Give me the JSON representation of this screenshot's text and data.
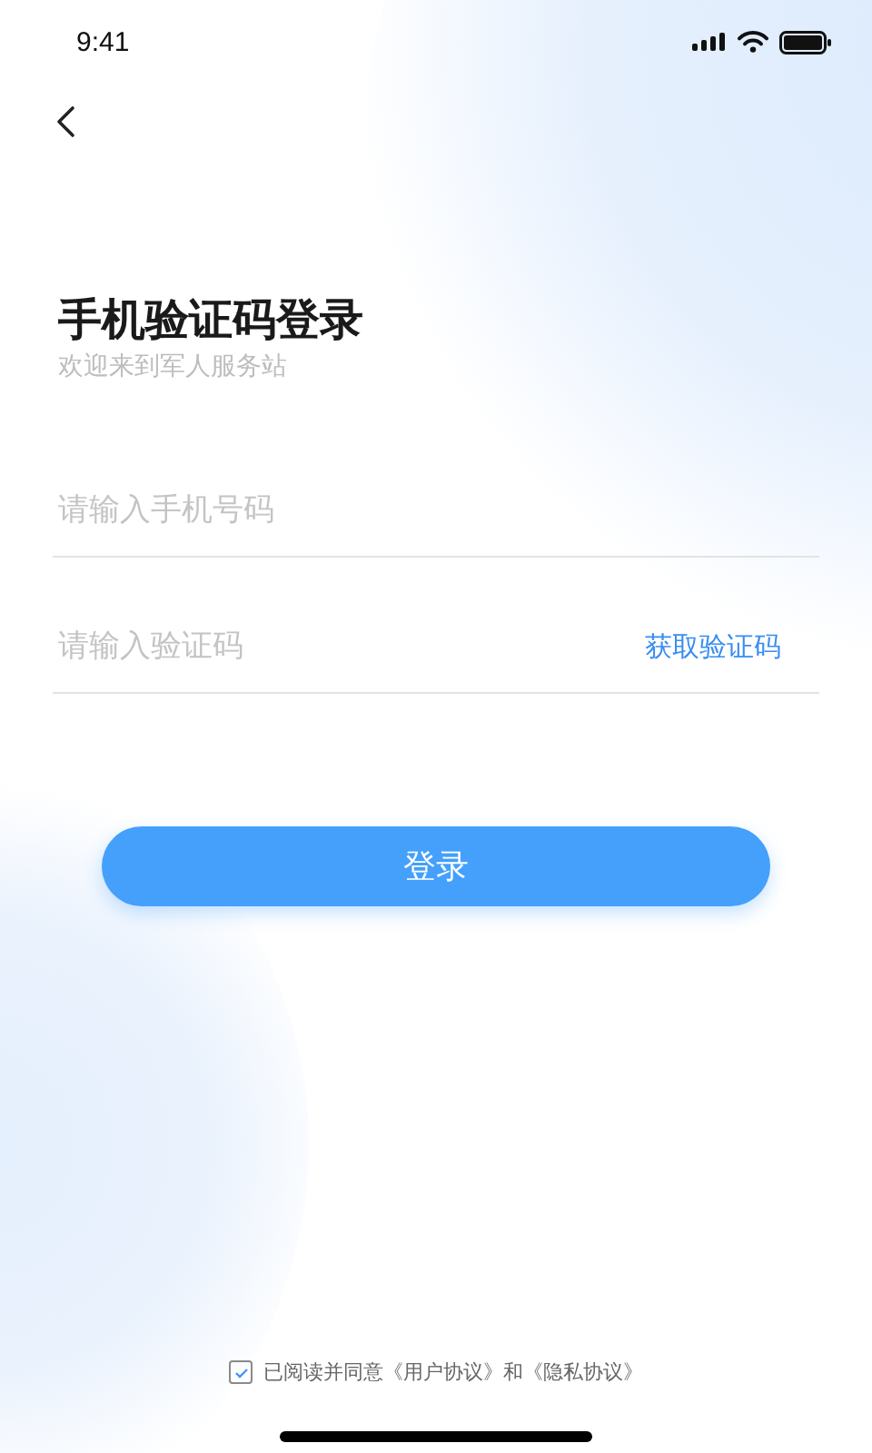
{
  "status_bar": {
    "time": "9:41"
  },
  "title": "手机验证码登录",
  "subtitle": "欢迎来到军人服务站",
  "phone_field": {
    "placeholder": "请输入手机号码"
  },
  "code_field": {
    "placeholder": "请输入验证码",
    "action": "获取验证码"
  },
  "login_button": "登录",
  "agreement": {
    "checked": true,
    "text": "已阅读并同意《用户协议》和《隐私协议》"
  }
}
